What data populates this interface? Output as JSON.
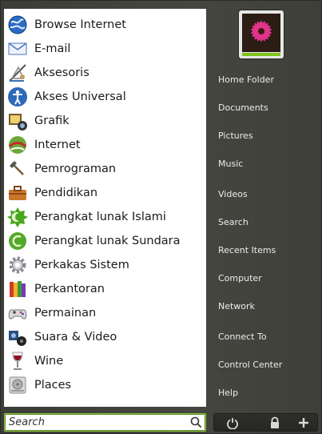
{
  "categories": [
    {
      "label": "Browse Internet",
      "icon": "globe-icon"
    },
    {
      "label": "E-mail",
      "icon": "envelope-icon"
    },
    {
      "label": "Aksesoris",
      "icon": "drafting-tools-icon"
    },
    {
      "label": "Akses Universal",
      "icon": "accessibility-icon"
    },
    {
      "label": "Grafik",
      "icon": "graphics-icon"
    },
    {
      "label": "Internet",
      "icon": "internet-icon"
    },
    {
      "label": "Pemrograman",
      "icon": "hammer-icon"
    },
    {
      "label": "Pendidikan",
      "icon": "toolbox-icon"
    },
    {
      "label": "Perangkat lunak Islami",
      "icon": "islamic-software-icon"
    },
    {
      "label": "Perangkat lunak Sundara",
      "icon": "sundara-software-icon"
    },
    {
      "label": "Perkakas Sistem",
      "icon": "system-gear-icon"
    },
    {
      "label": "Perkantoran",
      "icon": "office-books-icon"
    },
    {
      "label": "Permainan",
      "icon": "gamepad-icon"
    },
    {
      "label": "Suara & Video",
      "icon": "sound-video-icon"
    },
    {
      "label": "Wine",
      "icon": "wine-glass-icon"
    },
    {
      "label": "Places",
      "icon": "drive-icon"
    }
  ],
  "places": [
    "Home Folder",
    "Documents",
    "Pictures",
    "Music",
    "Videos",
    "Search",
    "Recent Items",
    "Computer",
    "Network",
    "Connect To",
    "Control Center",
    "Help"
  ],
  "search": {
    "placeholder": "Search"
  },
  "actions": [
    {
      "icon": "power-icon"
    },
    {
      "icon": "lock-icon"
    },
    {
      "icon": "plus-icon"
    }
  ],
  "colors": {
    "accent": "#7fc31c",
    "panel": "#ffffff",
    "sidebar": "#41423c"
  }
}
